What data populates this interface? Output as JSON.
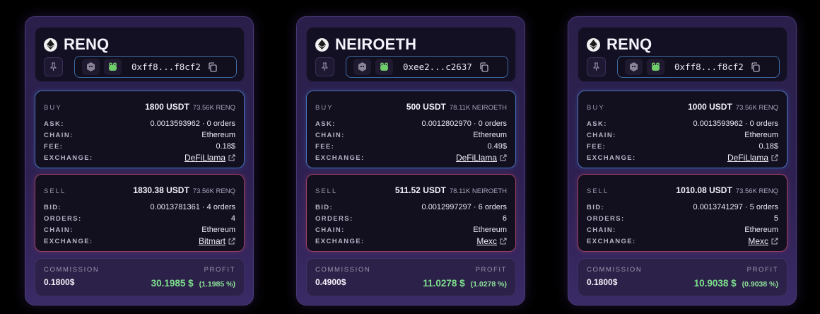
{
  "cards": [
    {
      "coin": "RENQ",
      "address": "0xff8...f8cf2",
      "buy": {
        "label": "BUY",
        "amount": "1800 USDT",
        "sub": "73.56K RENQ",
        "rows": [
          {
            "label": "ASK:",
            "value": "0.0013593962 · 0 orders"
          },
          {
            "label": "CHAIN:",
            "value": "Ethereum"
          },
          {
            "label": "FEE:",
            "value": "0.18$"
          }
        ],
        "exchange_label": "EXCHANGE:",
        "exchange": "DeFiLlama"
      },
      "sell": {
        "label": "SELL",
        "amount": "1830.38 USDT",
        "sub": "73.56K RENQ",
        "rows": [
          {
            "label": "BID:",
            "value": "0.0013781361 · 4 orders"
          },
          {
            "label": "ORDERS:",
            "value": "4"
          },
          {
            "label": "CHAIN:",
            "value": "Ethereum"
          }
        ],
        "exchange_label": "EXCHANGE:",
        "exchange": "Bitmart"
      },
      "commission_label": "COMMISSION",
      "commission": "0.1800$",
      "profit_label": "PROFIT",
      "profit": "30.1985 $",
      "profit_pct": "(1.1985 %)"
    },
    {
      "coin": "NEIROETH",
      "address": "0xee2...c2637",
      "buy": {
        "label": "BUY",
        "amount": "500 USDT",
        "sub": "78.11K NEIROETH",
        "rows": [
          {
            "label": "ASK:",
            "value": "0.0012802970 · 0 orders"
          },
          {
            "label": "CHAIN:",
            "value": "Ethereum"
          },
          {
            "label": "FEE:",
            "value": "0.49$"
          }
        ],
        "exchange_label": "EXCHANGE:",
        "exchange": "DeFiLlama"
      },
      "sell": {
        "label": "SELL",
        "amount": "511.52 USDT",
        "sub": "78.11K NEIROETH",
        "rows": [
          {
            "label": "BID:",
            "value": "0.0012997297 · 6 orders"
          },
          {
            "label": "ORDERS:",
            "value": "6"
          },
          {
            "label": "CHAIN:",
            "value": "Ethereum"
          }
        ],
        "exchange_label": "EXCHANGE:",
        "exchange": "Mexc"
      },
      "commission_label": "COMMISSION",
      "commission": "0.4900$",
      "profit_label": "PROFIT",
      "profit": "11.0278 $",
      "profit_pct": "(1.0278 %)"
    },
    {
      "coin": "RENQ",
      "address": "0xff8...f8cf2",
      "buy": {
        "label": "BUY",
        "amount": "1000 USDT",
        "sub": "73.56K RENQ",
        "rows": [
          {
            "label": "ASK:",
            "value": "0.0013593962 · 0 orders"
          },
          {
            "label": "CHAIN:",
            "value": "Ethereum"
          },
          {
            "label": "FEE:",
            "value": "0.18$"
          }
        ],
        "exchange_label": "EXCHANGE:",
        "exchange": "DeFiLlama"
      },
      "sell": {
        "label": "SELL",
        "amount": "1010.08 USDT",
        "sub": "73.56K RENQ",
        "rows": [
          {
            "label": "BID:",
            "value": "0.0013741297 · 5 orders"
          },
          {
            "label": "ORDERS:",
            "value": "5"
          },
          {
            "label": "CHAIN:",
            "value": "Ethereum"
          }
        ],
        "exchange_label": "EXCHANGE:",
        "exchange": "Mexc"
      },
      "commission_label": "COMMISSION",
      "commission": "0.1800$",
      "profit_label": "PROFIT",
      "profit": "10.9038 $",
      "profit_pct": "(0.9038 %)"
    }
  ],
  "icons": {
    "coin": "ethereum-icon",
    "pin": "pin-icon",
    "dex_a": "robot-icon",
    "dex_b": "frog-icon",
    "copy": "copy-icon",
    "external": "external-link-icon"
  },
  "colors": {
    "buy_border": "#4670b8",
    "sell_border": "#9a3f64",
    "profit": "#7ee08e",
    "card_bg": "#2a1f4a"
  }
}
